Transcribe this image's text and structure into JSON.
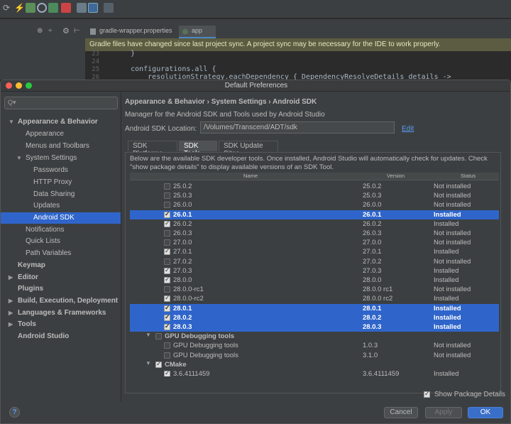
{
  "ide": {
    "file_tabs": [
      "gradle-wrapper.properties",
      "app"
    ],
    "notice": "Gradle files have changed since last project sync. A project sync may be necessary for the IDE to work properly.",
    "code_lines": [
      {
        "num": "23",
        "text": "    }"
      },
      {
        "num": "24",
        "text": ""
      },
      {
        "num": "25",
        "text": "    configurations.all {"
      },
      {
        "num": "26",
        "text": "        resolutionStrategy.eachDependency { DependencyResolveDetails details ->"
      }
    ]
  },
  "dialog": {
    "title": "Default Preferences",
    "search_placeholder": "Q▾",
    "nav": [
      {
        "label": "Appearance & Behavior",
        "level": 0,
        "expanded": true,
        "bold": true
      },
      {
        "label": "Appearance",
        "level": 1
      },
      {
        "label": "Menus and Toolbars",
        "level": 1
      },
      {
        "label": "System Settings",
        "level": 1,
        "expanded": true
      },
      {
        "label": "Passwords",
        "level": 2
      },
      {
        "label": "HTTP Proxy",
        "level": 2
      },
      {
        "label": "Data Sharing",
        "level": 2
      },
      {
        "label": "Updates",
        "level": 2
      },
      {
        "label": "Android SDK",
        "level": 2,
        "selected": true
      },
      {
        "label": "Notifications",
        "level": 1
      },
      {
        "label": "Quick Lists",
        "level": 1
      },
      {
        "label": "Path Variables",
        "level": 1
      },
      {
        "label": "Keymap",
        "level": 0,
        "bold": true
      },
      {
        "label": "Editor",
        "level": 0,
        "collapsed": true,
        "bold": true
      },
      {
        "label": "Plugins",
        "level": 0,
        "bold": true
      },
      {
        "label": "Build, Execution, Deployment",
        "level": 0,
        "collapsed": true,
        "bold": true
      },
      {
        "label": "Languages & Frameworks",
        "level": 0,
        "collapsed": true,
        "bold": true
      },
      {
        "label": "Tools",
        "level": 0,
        "collapsed": true,
        "bold": true
      },
      {
        "label": "Android Studio",
        "level": 0,
        "bold": true
      }
    ],
    "breadcrumb": "Appearance & Behavior  ›  System Settings  ›  Android SDK",
    "description": "Manager for the Android SDK and Tools used by Android Studio",
    "location_label": "Android SDK Location:",
    "location_value": "/Volumes/Transcend/ADT/sdk",
    "edit_label": "Edit",
    "tabs": [
      {
        "label": "SDK Platforms",
        "active": false
      },
      {
        "label": "SDK Tools",
        "active": true
      },
      {
        "label": "SDK Update Sites",
        "active": false
      }
    ],
    "info": "Below are the available SDK developer tools. Once installed, Android Studio will automatically check for updates. Check \"show package details\" to display available versions of an SDK Tool.",
    "columns": {
      "name": "Name",
      "version": "Version",
      "status": "Status"
    },
    "rows": [
      {
        "name": "25.0.2",
        "version": "25.0.2",
        "status": "Not installed",
        "checked": false,
        "indent": 2
      },
      {
        "name": "25.0.3",
        "version": "25.0.3",
        "status": "Not installed",
        "checked": false,
        "indent": 2
      },
      {
        "name": "26.0.0",
        "version": "26.0.0",
        "status": "Not installed",
        "checked": false,
        "indent": 2
      },
      {
        "name": "26.0.1",
        "version": "26.0.1",
        "status": "Installed",
        "checked": true,
        "indent": 2,
        "selected": true
      },
      {
        "name": "26.0.2",
        "version": "26.0.2",
        "status": "Installed",
        "checked": true,
        "indent": 2
      },
      {
        "name": "26.0.3",
        "version": "26.0.3",
        "status": "Not installed",
        "checked": false,
        "indent": 2
      },
      {
        "name": "27.0.0",
        "version": "27.0.0",
        "status": "Not installed",
        "checked": false,
        "indent": 2
      },
      {
        "name": "27.0.1",
        "version": "27.0.1",
        "status": "Installed",
        "checked": true,
        "indent": 2
      },
      {
        "name": "27.0.2",
        "version": "27.0.2",
        "status": "Not installed",
        "checked": false,
        "indent": 2
      },
      {
        "name": "27.0.3",
        "version": "27.0.3",
        "status": "Installed",
        "checked": true,
        "indent": 2
      },
      {
        "name": "28.0.0",
        "version": "28.0.0",
        "status": "Installed",
        "checked": true,
        "indent": 2
      },
      {
        "name": "28.0.0-rc1",
        "version": "28.0.0 rc1",
        "status": "Not installed",
        "checked": false,
        "indent": 2
      },
      {
        "name": "28.0.0-rc2",
        "version": "28.0.0 rc2",
        "status": "Installed",
        "checked": true,
        "indent": 2
      },
      {
        "name": "28.0.1",
        "version": "28.0.1",
        "status": "Installed",
        "checked": true,
        "indent": 2,
        "selected": true
      },
      {
        "name": "28.0.2",
        "version": "28.0.2",
        "status": "Installed",
        "checked": true,
        "indent": 2,
        "selected": true
      },
      {
        "name": "28.0.3",
        "version": "28.0.3",
        "status": "Installed",
        "checked": true,
        "indent": 2,
        "selected": true
      },
      {
        "name": "GPU Debugging tools",
        "version": "",
        "status": "",
        "checked": false,
        "indent": 1,
        "group": true
      },
      {
        "name": "GPU Debugging tools",
        "version": "1.0.3",
        "status": "Not installed",
        "checked": false,
        "indent": 2
      },
      {
        "name": "GPU Debugging tools",
        "version": "3.1.0",
        "status": "Not installed",
        "checked": false,
        "indent": 2
      },
      {
        "name": "CMake",
        "version": "",
        "status": "",
        "checked": true,
        "indent": 1,
        "group": true
      },
      {
        "name": "3.6.4111459",
        "version": "3.6.4111459",
        "status": "Installed",
        "checked": true,
        "indent": 2
      }
    ],
    "show_package_details": "Show Package Details",
    "buttons": {
      "help": "?",
      "cancel": "Cancel",
      "apply": "Apply",
      "ok": "OK"
    }
  }
}
